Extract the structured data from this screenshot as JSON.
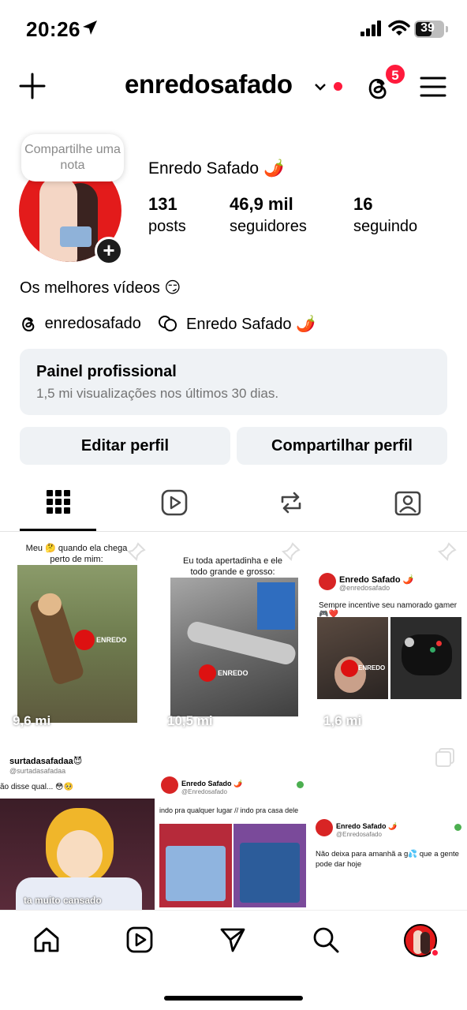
{
  "status_bar": {
    "time": "20:26",
    "battery": "39"
  },
  "header": {
    "username": "enredosafado",
    "threads_badge": "5"
  },
  "profile": {
    "note_bubble": "Compartilhe uma nota",
    "display_name": "Enredo Safado 🌶️",
    "stats": [
      {
        "value": "131",
        "label": "posts"
      },
      {
        "value": "46,9 mil",
        "label": "seguidores"
      },
      {
        "value": "16",
        "label": "seguindo"
      }
    ],
    "bio": "Os melhores vídeos 😏",
    "threads_link": "enredosafado",
    "facebook_link": "Enredo Safado 🌶️"
  },
  "pro_panel": {
    "title": "Painel profissional",
    "subtitle": "1,5 mi visualizações nos últimos 30 dias."
  },
  "buttons": {
    "edit": "Editar perfil",
    "share": "Compartilhar perfil"
  },
  "tabs": [
    "grid-icon",
    "reels-icon",
    "reposts-icon",
    "tagged-icon"
  ],
  "posts": [
    {
      "caption": "Meu 🤔 quando ela chega perto de mim:",
      "views": "9,6 mi",
      "watermark": "ENREDO"
    },
    {
      "caption": "Eu toda apertadinha e ele todo grande e grosso:",
      "views": "10,5 mi",
      "watermark": "ENREDO"
    },
    {
      "author": "Enredo Safado 🌶️",
      "handle": "@enredosafado",
      "text": "Sempre incentive seu namorado gamer 🎮❤️",
      "views": "1,6 mi",
      "watermark": "ENREDO"
    },
    {
      "author": "surtadasafadaa😈",
      "handle": "@surtadasafadaa",
      "text": "ão disse qual... 😳🥺",
      "overlay": "ta muito cansado"
    },
    {
      "author": "Enredo Safado 🌶️",
      "handle": "@Enredosafado",
      "text": "indo pra qualquer lugar // indo pra casa dele"
    },
    {
      "author": "Enredo Safado 🌶️",
      "handle": "@Enredosafado",
      "text": "Não deixa para amanhã a g💦 que a gente pode dar hoje"
    }
  ],
  "colors": {
    "accent_red": "#ff1a3c",
    "panel_bg": "#eff2f5"
  }
}
